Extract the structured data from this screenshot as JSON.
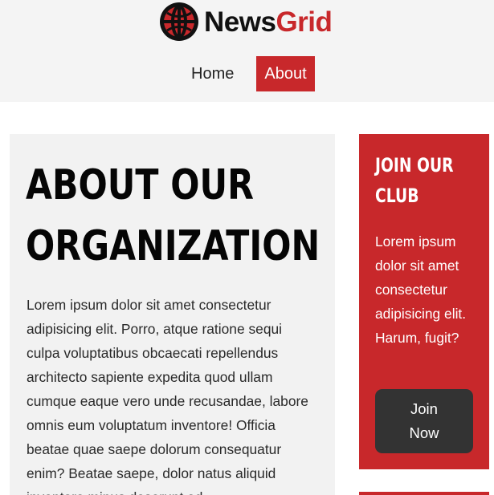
{
  "header": {
    "logo_icon": "globe-icon",
    "brand_part1": "News",
    "brand_part2": "Grid",
    "brand_colors": {
      "news": "#111111",
      "grid": "#c8282b"
    }
  },
  "nav": {
    "items": [
      {
        "label": "Home",
        "active": false
      },
      {
        "label": "About",
        "active": true
      }
    ],
    "active_color": "#c8282b"
  },
  "main": {
    "title_line1": "ABOUT OUR",
    "title_line2": "ORGANIZATION",
    "body": "Lorem ipsum dolor sit amet consectetur adipisicing elit. Porro, atque ratione sequi culpa voluptatibus obcaecati repellendus architecto sapiente expedita quod ullam cumque eaque vero unde recusandae, labore omnis eum voluptatum inventore! Officia beatae quae saepe dolorum consequatur enim? Beatae saepe, dolor natus aliquid inventore minus deserunt ad"
  },
  "sidebar": {
    "title_line1": "JOIN OUR",
    "title_line2": "CLUB",
    "text": "Lorem ipsum dolor sit amet consectetur adipisicing elit. Harum, fugit?",
    "button_label": "Join Now",
    "background_color": "#c8282b",
    "button_color": "#333333"
  }
}
